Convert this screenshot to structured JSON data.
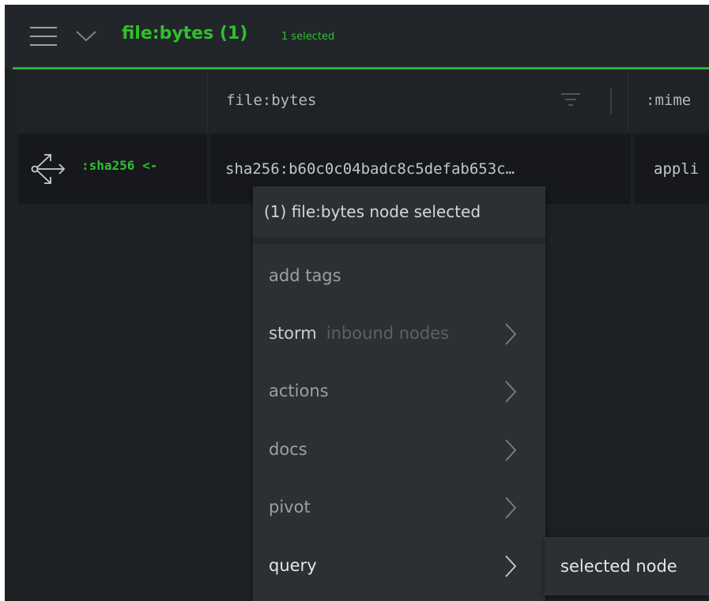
{
  "header": {
    "title": "file:bytes (1)",
    "subtitle": "1 selected"
  },
  "table": {
    "columns": [
      "file:bytes",
      ":mime"
    ],
    "row": {
      "relation": ":sha256 <-",
      "sha": "sha256:b60c0c04badc8c5defab653c…",
      "mime": "appli"
    }
  },
  "menu": {
    "header": "(1) file:bytes node selected",
    "items": [
      {
        "label": "add tags"
      },
      {
        "label": "storm",
        "hint": "inbound nodes"
      },
      {
        "label": "actions"
      },
      {
        "label": "docs"
      },
      {
        "label": "pivot"
      },
      {
        "label": "query"
      }
    ]
  },
  "submenu": {
    "items": [
      {
        "label": "selected node"
      }
    ]
  },
  "colors": {
    "accent": "#2fbf2f",
    "background": "#1e2124",
    "menu": "#2c3034"
  },
  "icons": [
    "menu-icon",
    "chevron-down-icon",
    "filter-icon",
    "pivot-arrows-icon",
    "chevron-right-icon"
  ]
}
